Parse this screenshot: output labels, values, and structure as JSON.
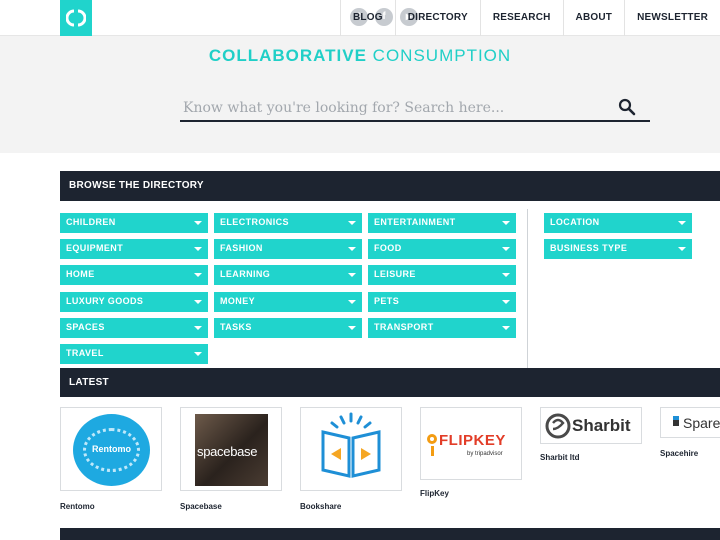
{
  "nav": {
    "items": [
      "BLOG",
      "DIRECTORY",
      "RESEARCH",
      "ABOUT",
      "NEWSLETTER"
    ],
    "social": [
      {
        "icon": "twitter-icon",
        "glyph": "t"
      },
      {
        "icon": "facebook-icon",
        "glyph": "f"
      },
      {
        "icon": "youtube-icon",
        "glyph": "▶"
      }
    ]
  },
  "hero": {
    "brand_bold": "COLLABORATIVE",
    "brand_light": "CONSUMPTION",
    "search_placeholder": "Know what you're looking for? Search here..."
  },
  "directory": {
    "title": "BROWSE THE DIRECTORY",
    "categories": [
      [
        "CHILDREN",
        "ELECTRONICS",
        "ENTERTAINMENT"
      ],
      [
        "EQUIPMENT",
        "FASHION",
        "FOOD"
      ],
      [
        "HOME",
        "LEARNING",
        "LEISURE"
      ],
      [
        "LUXURY GOODS",
        "MONEY",
        "PETS"
      ],
      [
        "SPACES",
        "TASKS",
        "TRANSPORT"
      ],
      [
        "TRAVEL"
      ]
    ],
    "filters": [
      "LOCATION",
      "BUSINESS TYPE"
    ]
  },
  "latest": {
    "title": "LATEST",
    "cards": [
      {
        "name": "Rentomo",
        "logo_text": "Rentomo"
      },
      {
        "name": "Spacebase",
        "logo_text": "spacebase"
      },
      {
        "name": "Bookshare",
        "logo_text": ""
      },
      {
        "name": "FlipKey",
        "logo_text": "FLIPKEY",
        "logo_sub": "by tripadvisor"
      },
      {
        "name": "Sharbit ltd",
        "logo_text": "Sharbit"
      },
      {
        "name": "Spacehire",
        "logo_text": "Spare"
      }
    ]
  },
  "colors": {
    "accent": "#20d4cc",
    "dark": "#1d2430"
  }
}
